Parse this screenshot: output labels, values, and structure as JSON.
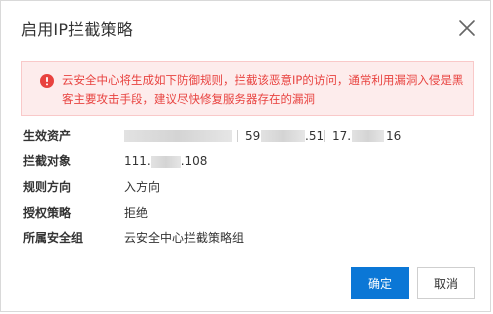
{
  "dialog": {
    "title": "启用IP拦截策略",
    "close_icon": "close-icon"
  },
  "alert": {
    "icon": "exclamation-circle-icon",
    "color": "#e8423f",
    "text": "云安全中心将生成如下防御规则，拦截该恶意IP的访问，通常利用漏洞入侵是黑客主要攻击手段，建议尽快修复服务器存在的漏洞"
  },
  "fields": {
    "assets": {
      "label": "生效资产",
      "item2_prefix": "59",
      "item2_suffix": ".51",
      "item3_prefix": "17.",
      "item3_suffix": "16"
    },
    "target": {
      "label": "拦截对象",
      "prefix": "111.",
      "suffix": ".108"
    },
    "direction": {
      "label": "规则方向",
      "value": "入方向"
    },
    "policy": {
      "label": "授权策略",
      "value": "拒绝"
    },
    "group": {
      "label": "所属安全组",
      "value": "云安全中心拦截策略组"
    }
  },
  "footer": {
    "confirm_label": "确定",
    "cancel_label": "取消",
    "primary_color": "#0b77d6"
  }
}
